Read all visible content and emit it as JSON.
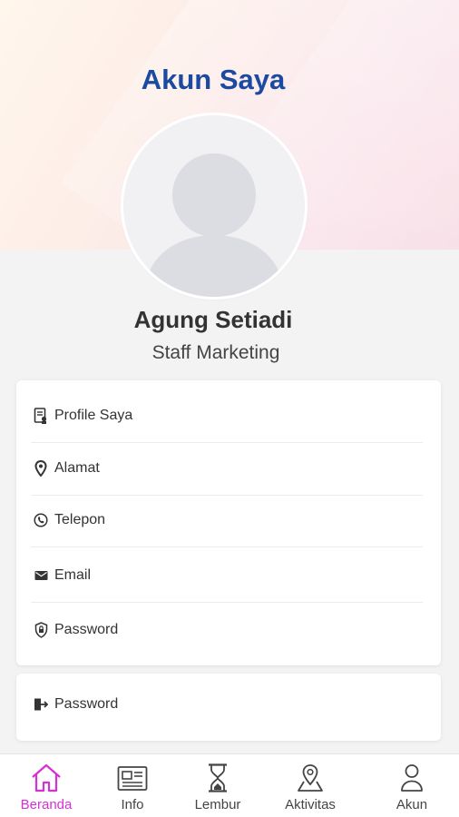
{
  "header": {
    "title": "Akun Saya"
  },
  "profile": {
    "name": "Agung Setiadi",
    "role": "Staff Marketing"
  },
  "menu": {
    "items": [
      {
        "label": "Profile Saya",
        "icon": "id-card-icon"
      },
      {
        "label": "Alamat",
        "icon": "location-pin-icon"
      },
      {
        "label": "Telepon",
        "icon": "phone-icon"
      },
      {
        "label": "Email",
        "icon": "mail-icon"
      },
      {
        "label": "Password",
        "icon": "shield-lock-icon"
      }
    ],
    "logout": {
      "label": "Password",
      "icon": "logout-icon"
    }
  },
  "bottom_nav": {
    "items": [
      {
        "label": "Beranda",
        "icon": "home-icon",
        "active": true
      },
      {
        "label": "Info",
        "icon": "news-icon",
        "active": false
      },
      {
        "label": "Lembur",
        "icon": "hourglass-icon",
        "active": false
      },
      {
        "label": "Aktivitas",
        "icon": "map-pin-icon",
        "active": false
      },
      {
        "label": "Akun",
        "icon": "user-icon",
        "active": false
      }
    ]
  },
  "colors": {
    "title": "#1c4aa0",
    "active_nav": "#d62fd6",
    "background": "#f3f3f3"
  }
}
